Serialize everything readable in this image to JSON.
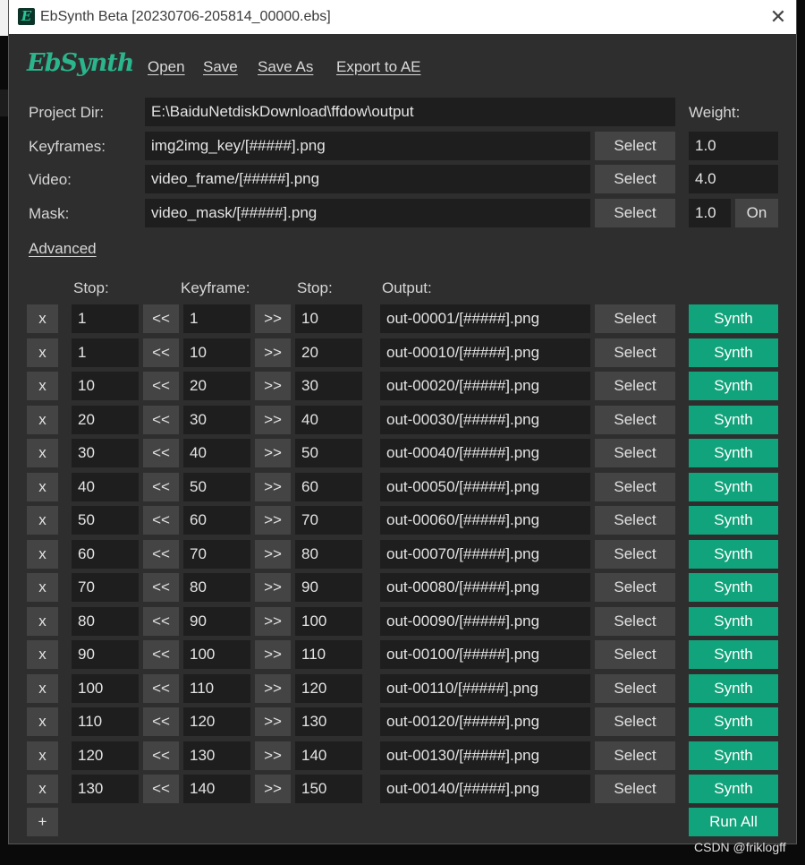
{
  "window": {
    "title": "EbSynth Beta [20230706-205814_00000.ebs]",
    "app_icon_glyph": "E",
    "close_glyph": "✕"
  },
  "logo_text": "EbSynth",
  "menu": {
    "open": "Open",
    "save": "Save",
    "save_as": "Save As",
    "export": "Export to AE"
  },
  "settings": {
    "project_dir_label": "Project Dir:",
    "project_dir_value": "E:\\BaiduNetdiskDownload\\ffdow\\output",
    "weight_label": "Weight:",
    "keyframes_label": "Keyframes:",
    "keyframes_value": "img2img_key/[#####].png",
    "keyframes_weight": "1.0",
    "video_label": "Video:",
    "video_value": "video_frame/[#####].png",
    "video_weight": "4.0",
    "mask_label": "Mask:",
    "mask_value": "video_mask/[#####].png",
    "mask_weight": "1.0",
    "mask_toggle": "On",
    "select_label": "Select"
  },
  "advanced_label": "Advanced",
  "table": {
    "headers": {
      "stop_start": "Stop:",
      "keyframe": "Keyframe:",
      "stop_end": "Stop:",
      "output": "Output:"
    },
    "remove_label": "x",
    "prev_label": "<<",
    "next_label": ">>",
    "select_label": "Select",
    "synth_label": "Synth",
    "rows": [
      {
        "stop_start": "1",
        "keyframe": "1",
        "stop_end": "10",
        "output": "out-00001/[#####].png"
      },
      {
        "stop_start": "1",
        "keyframe": "10",
        "stop_end": "20",
        "output": "out-00010/[#####].png"
      },
      {
        "stop_start": "10",
        "keyframe": "20",
        "stop_end": "30",
        "output": "out-00020/[#####].png"
      },
      {
        "stop_start": "20",
        "keyframe": "30",
        "stop_end": "40",
        "output": "out-00030/[#####].png"
      },
      {
        "stop_start": "30",
        "keyframe": "40",
        "stop_end": "50",
        "output": "out-00040/[#####].png"
      },
      {
        "stop_start": "40",
        "keyframe": "50",
        "stop_end": "60",
        "output": "out-00050/[#####].png"
      },
      {
        "stop_start": "50",
        "keyframe": "60",
        "stop_end": "70",
        "output": "out-00060/[#####].png"
      },
      {
        "stop_start": "60",
        "keyframe": "70",
        "stop_end": "80",
        "output": "out-00070/[#####].png"
      },
      {
        "stop_start": "70",
        "keyframe": "80",
        "stop_end": "90",
        "output": "out-00080/[#####].png"
      },
      {
        "stop_start": "80",
        "keyframe": "90",
        "stop_end": "100",
        "output": "out-00090/[#####].png"
      },
      {
        "stop_start": "90",
        "keyframe": "100",
        "stop_end": "110",
        "output": "out-00100/[#####].png"
      },
      {
        "stop_start": "100",
        "keyframe": "110",
        "stop_end": "120",
        "output": "out-00110/[#####].png"
      },
      {
        "stop_start": "110",
        "keyframe": "120",
        "stop_end": "130",
        "output": "out-00120/[#####].png"
      },
      {
        "stop_start": "120",
        "keyframe": "130",
        "stop_end": "140",
        "output": "out-00130/[#####].png"
      },
      {
        "stop_start": "130",
        "keyframe": "140",
        "stop_end": "150",
        "output": "out-00140/[#####].png"
      }
    ],
    "add_label": "+",
    "run_all_label": "Run All"
  },
  "watermark": "CSDN @friklogff",
  "colors": {
    "accent": "#11a37b",
    "background": "#2e2e2e",
    "field": "#1e1e1e",
    "button": "#444444"
  }
}
